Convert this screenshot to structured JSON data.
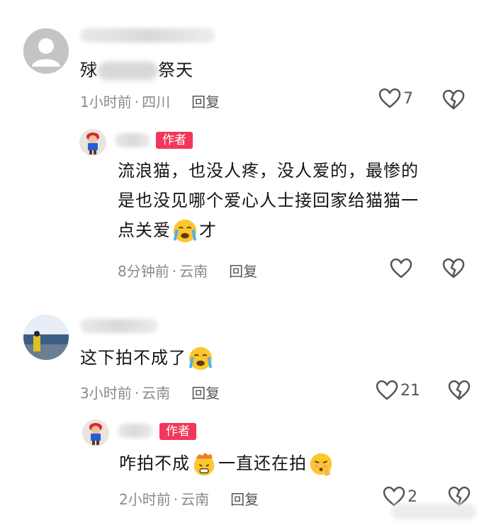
{
  "comments": [
    {
      "text_start": "殏",
      "text_end": "祭天",
      "time": "1小时前",
      "location": "四川",
      "reply_label": "回复",
      "likes": "7"
    },
    {
      "author_tag": "作者",
      "text_lines": [
        "流浪猫，也没人疼，没人爱的，最惨的",
        "是也没见哪个爱心人士接回家给猫猫一",
        "点关爱"
      ],
      "text_tail": "才",
      "time": "8分钟前",
      "location": "云南",
      "reply_label": "回复",
      "likes": ""
    },
    {
      "text": "这下拍不成了",
      "time": "3小时前",
      "location": "云南",
      "reply_label": "回复",
      "likes": "21"
    },
    {
      "author_tag": "作者",
      "text_a": "咋拍不成",
      "text_b": "一直还在拍",
      "time": "2小时前",
      "location": "云南",
      "reply_label": "回复",
      "likes": "2"
    }
  ],
  "meta_separator": "·",
  "icons": {
    "like": "heart-outline-icon",
    "dislike": "broken-heart-icon",
    "crying": "crying-face-emoji",
    "fire": "fire-face-emoji",
    "shush": "shushing-face-emoji"
  },
  "colors": {
    "author_tag_bg": "#f2375a",
    "meta_text": "#8a8a8a"
  }
}
